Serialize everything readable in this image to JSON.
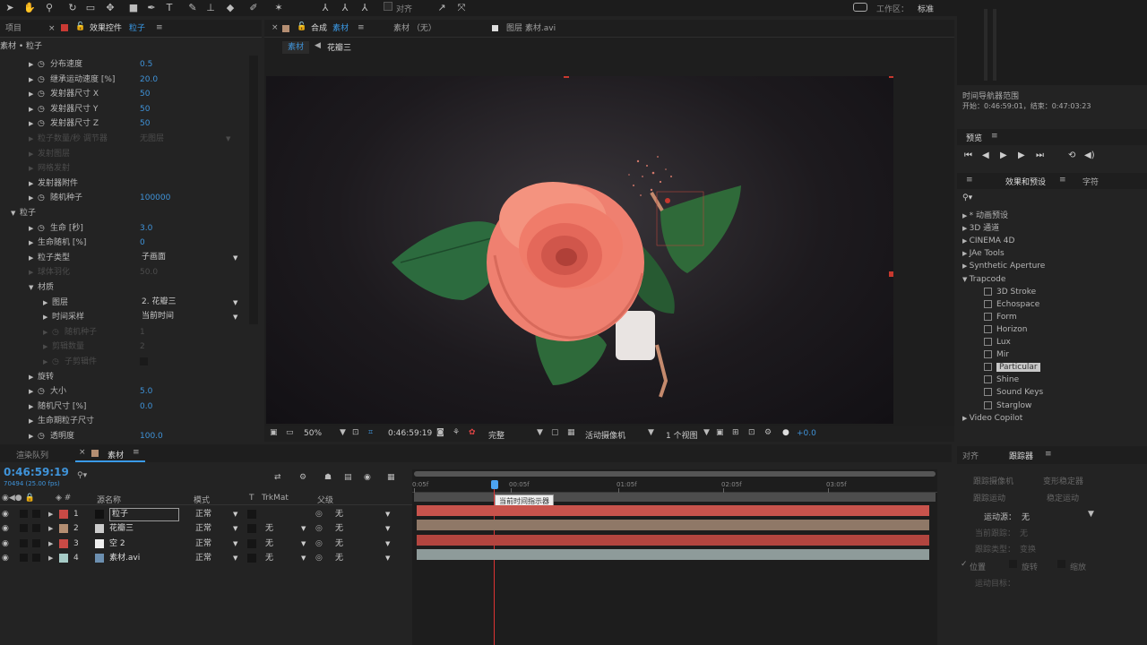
{
  "toolbar": {
    "align_label": "对齐",
    "workspace_label": "工作区：",
    "workspace_value": "标准"
  },
  "left_panel": {
    "tab_project": "项目",
    "tab_effects": "效果控件",
    "tab_effects_layer": "粒子",
    "breadcrumb": "素材 • 粒子",
    "rows": [
      {
        "indent": 1,
        "stopwatch": true,
        "label": "分布速度",
        "value": "0.5",
        "state": "normal"
      },
      {
        "indent": 1,
        "stopwatch": true,
        "label": "继承运动速度 [%]",
        "value": "20.0",
        "state": "normal"
      },
      {
        "indent": 1,
        "stopwatch": true,
        "label": "发射器尺寸 X",
        "value": "50",
        "state": "normal"
      },
      {
        "indent": 1,
        "stopwatch": true,
        "label": "发射器尺寸 Y",
        "value": "50",
        "state": "normal"
      },
      {
        "indent": 1,
        "stopwatch": true,
        "label": "发射器尺寸 Z",
        "value": "50",
        "state": "normal"
      },
      {
        "indent": 1,
        "stopwatch": false,
        "label": "粒子数量/秒 调节器",
        "value": "无图层",
        "state": "dim"
      },
      {
        "indent": 1,
        "stopwatch": false,
        "label": "发射图层",
        "value": "",
        "state": "dim"
      },
      {
        "indent": 1,
        "stopwatch": false,
        "label": "网格发射",
        "value": "",
        "state": "dim"
      },
      {
        "indent": 1,
        "stopwatch": false,
        "label": "发射器附件",
        "value": "",
        "state": "normal",
        "arrow": true
      },
      {
        "indent": 1,
        "stopwatch": true,
        "label": "随机种子",
        "value": "100000",
        "state": "normal"
      },
      {
        "indent": 0,
        "stopwatch": false,
        "label": "粒子",
        "value": "",
        "state": "section"
      },
      {
        "indent": 1,
        "stopwatch": true,
        "label": "生命 [秒]",
        "value": "3.0",
        "state": "normal"
      },
      {
        "indent": 1,
        "stopwatch": false,
        "label": "生命随机 [%]",
        "value": "0",
        "state": "normal",
        "arrow": true
      },
      {
        "indent": 1,
        "stopwatch": false,
        "label": "粒子类型",
        "value": "子画面",
        "state": "dropdown"
      },
      {
        "indent": 1,
        "stopwatch": false,
        "label": "球体羽化",
        "value": "50.0",
        "state": "dim"
      },
      {
        "indent": 1,
        "stopwatch": false,
        "label": "材质",
        "value": "",
        "state": "section2"
      },
      {
        "indent": 2,
        "stopwatch": false,
        "label": "图层",
        "value": "2. 花瓣三",
        "state": "dropdown"
      },
      {
        "indent": 2,
        "stopwatch": false,
        "label": "时间采样",
        "value": "当前时间",
        "state": "dropdown"
      },
      {
        "indent": 2,
        "stopwatch": true,
        "label": "随机种子",
        "value": "1",
        "state": "dim"
      },
      {
        "indent": 2,
        "stopwatch": false,
        "label": "剪辑数量",
        "value": "2",
        "state": "dim"
      },
      {
        "indent": 2,
        "stopwatch": true,
        "label": "子剪辑件",
        "value": "",
        "state": "dim"
      },
      {
        "indent": 1,
        "stopwatch": false,
        "label": "旋转",
        "value": "",
        "state": "normal",
        "arrow": true
      },
      {
        "indent": 1,
        "stopwatch": true,
        "label": "大小",
        "value": "5.0",
        "state": "normal"
      },
      {
        "indent": 1,
        "stopwatch": false,
        "label": "随机尺寸 [%]",
        "value": "0.0",
        "state": "normal",
        "arrow": true
      },
      {
        "indent": 1,
        "stopwatch": false,
        "label": "生命期粒子尺寸",
        "value": "",
        "state": "normal",
        "arrow": true
      },
      {
        "indent": 1,
        "stopwatch": true,
        "label": "透明度",
        "value": "100.0",
        "state": "normal"
      }
    ]
  },
  "composition": {
    "tab_label": "合成",
    "tab_comp_name": "素材",
    "tab_footage": "素材 （无）",
    "tab_layer": "图层 素材.avi",
    "crumb_1": "素材",
    "crumb_2": "花瓣三",
    "viewbar": {
      "zoom": "50%",
      "timecode": "0:46:59:19",
      "quality": "完整",
      "camera": "活动摄像机",
      "views": "1 个视图",
      "exposure": "+0.0"
    }
  },
  "right_panel": {
    "nav_title": "时间导航器范围",
    "nav_range": "开始：0:46:59:01，结束：0:47:03:23",
    "preview_tab": "预览",
    "fx_tab": "效果和预设",
    "char_tab": "字符",
    "effects": [
      {
        "label": "* 动画预设",
        "type": "folder",
        "open": false
      },
      {
        "label": "3D 通道",
        "type": "folder",
        "open": false
      },
      {
        "label": "CINEMA 4D",
        "type": "folder",
        "open": false
      },
      {
        "label": "JAe Tools",
        "type": "folder",
        "open": false
      },
      {
        "label": "Synthetic Aperture",
        "type": "folder",
        "open": false
      },
      {
        "label": "Trapcode",
        "type": "folder",
        "open": true
      },
      {
        "label": "3D Stroke",
        "type": "item"
      },
      {
        "label": "Echospace",
        "type": "item"
      },
      {
        "label": "Form",
        "type": "item"
      },
      {
        "label": "Horizon",
        "type": "item"
      },
      {
        "label": "Lux",
        "type": "item"
      },
      {
        "label": "Mir",
        "type": "item"
      },
      {
        "label": "Particular",
        "type": "item",
        "selected": true
      },
      {
        "label": "Shine",
        "type": "item"
      },
      {
        "label": "Sound Keys",
        "type": "item"
      },
      {
        "label": "Starglow",
        "type": "item"
      },
      {
        "label": "Video Copilot",
        "type": "folder",
        "open": false
      }
    ],
    "tracker_tab_1": "对齐",
    "tracker_tab_2": "跟踪器",
    "tracker_btn_1": "跟踪摄像机",
    "tracker_btn_2": "变形稳定器",
    "tracker_btn_3": "跟踪运动",
    "tracker_btn_4": "稳定运动",
    "tracker_source_label": "运动源：",
    "tracker_source_value": "无",
    "tracker_current_label": "当前跟踪：",
    "tracker_current_value": "无",
    "tracker_type_label": "跟踪类型：",
    "tracker_type_value": "变换",
    "tracker_pos": "位置",
    "tracker_rot": "旋转",
    "tracker_scale": "缩放",
    "tracker_target": "运动目标："
  },
  "timeline": {
    "tab_render": "渲染队列",
    "tab_comp": "素材",
    "timecode": "0:46:59:19",
    "frame_info": "70494 (25.00 fps)",
    "col_name": "源名称",
    "col_mode": "模式",
    "col_t": "T",
    "col_trkmat": "TrkMat",
    "col_parent": "父级",
    "ruler": [
      "0:05f",
      "00:05f",
      "01:05f",
      "02:05f",
      "03:05f"
    ],
    "tooltip": "当前时间指示器",
    "layers": [
      {
        "num": "1",
        "name": "粒子",
        "mode": "正常",
        "trkmat": "",
        "parent": "无",
        "color": "#c94a45",
        "bar": "#c8534c",
        "selected": true
      },
      {
        "num": "2",
        "name": "花瓣三",
        "mode": "正常",
        "trkmat": "无",
        "parent": "无",
        "color": "#b48e72",
        "bar": "#8f7867",
        "selected": false
      },
      {
        "num": "3",
        "name": "空 2",
        "mode": "正常",
        "trkmat": "无",
        "parent": "无",
        "color": "#c94a45",
        "bar": "#b2453f",
        "selected": false
      },
      {
        "num": "4",
        "name": "素材.avi",
        "mode": "正常",
        "trkmat": "无",
        "parent": "无",
        "color": "#a7ccc7",
        "bar": "#8e9b9a",
        "selected": false
      }
    ]
  }
}
